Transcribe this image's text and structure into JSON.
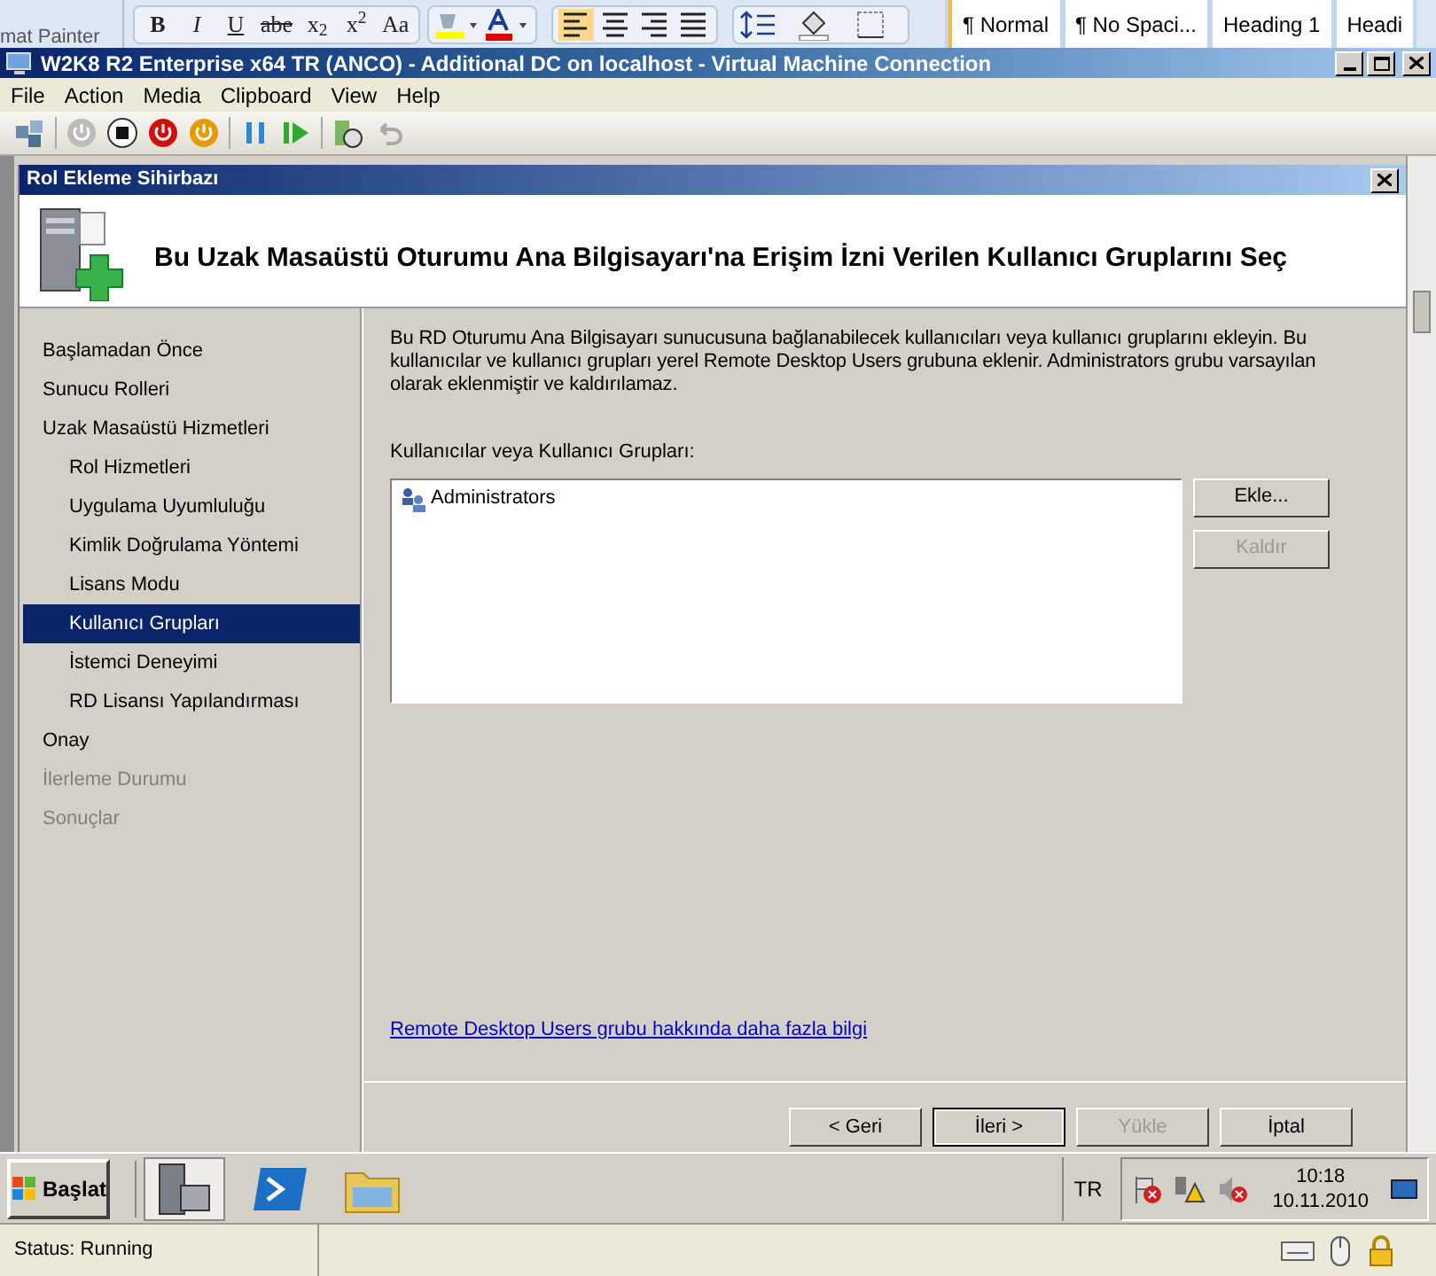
{
  "word_ribbon": {
    "cut_label": "mat Painter",
    "format_buttons": [
      "B",
      "I",
      "U",
      "abe",
      "x$_{2}$",
      "x$^{2}$",
      "Aa"
    ],
    "styles": [
      {
        "label": "¶ Normal",
        "selected": true
      },
      {
        "label": "¶ No Spaci...",
        "selected": false
      },
      {
        "label": "Heading 1",
        "selected": false
      },
      {
        "label": "Headi",
        "selected": false
      }
    ]
  },
  "vm_window": {
    "title": "W2K8 R2 Enterprise x64 TR (ANCO) - Additional DC on localhost - Virtual Machine Connection",
    "menu": [
      "File",
      "Action",
      "Media",
      "Clipboard",
      "View",
      "Help"
    ]
  },
  "wizard": {
    "title": "Rol Ekleme Sihirbazı",
    "heading": "Bu Uzak Masaüstü Oturumu Ana Bilgisayarı'na Erişim İzni Verilen Kullanıcı Gruplarını Seç",
    "nav": [
      {
        "label": "Başlamadan Önce",
        "selected": false,
        "disabled": false
      },
      {
        "label": "Sunucu Rolleri",
        "selected": false,
        "disabled": false
      },
      {
        "label": "Uzak Masaüstü Hizmetleri",
        "selected": false,
        "disabled": false,
        "children": [
          {
            "label": "Rol Hizmetleri",
            "selected": false,
            "disabled": false
          },
          {
            "label": "Uygulama Uyumluluğu",
            "selected": false,
            "disabled": false
          },
          {
            "label": "Kimlik Doğrulama Yöntemi",
            "selected": false,
            "disabled": false
          },
          {
            "label": "Lisans Modu",
            "selected": false,
            "disabled": false
          },
          {
            "label": "Kullanıcı Grupları",
            "selected": true,
            "disabled": false
          },
          {
            "label": "İstemci Deneyimi",
            "selected": false,
            "disabled": false
          },
          {
            "label": "RD Lisansı Yapılandırması",
            "selected": false,
            "disabled": false
          }
        ]
      },
      {
        "label": "Onay",
        "selected": false,
        "disabled": false
      },
      {
        "label": "İlerleme Durumu",
        "selected": false,
        "disabled": true
      },
      {
        "label": "Sonuçlar",
        "selected": false,
        "disabled": true
      }
    ],
    "description": "Bu RD Oturumu Ana Bilgisayarı sunucusuna bağlanabilecek kullanıcıları veya kullanıcı gruplarını ekleyin. Bu kullanıcılar ve kullanıcı grupları yerel Remote Desktop Users grubuna eklenir. Administrators grubu varsayılan olarak eklenmiştir ve kaldırılamaz.",
    "list_label": "Kullanıcılar veya Kullanıcı Grupları:",
    "list_items": [
      "Administrators"
    ],
    "side_buttons": [
      {
        "label": "Ekle...",
        "disabled": false
      },
      {
        "label": "Kaldır",
        "disabled": true
      }
    ],
    "link": "Remote Desktop Users grubu hakkında daha fazla bilgi",
    "footer_buttons": [
      {
        "label": "< Geri",
        "disabled": false,
        "default": false
      },
      {
        "label": "İleri >",
        "disabled": false,
        "default": true
      },
      {
        "label": "Yükle",
        "disabled": true,
        "default": false
      },
      {
        "label": "İptal",
        "disabled": false,
        "default": false
      }
    ]
  },
  "taskbar": {
    "start": "Başlat",
    "language": "TR",
    "time": "10:18",
    "date": "10.11.2010"
  },
  "status_bar": {
    "status": "Status: Running"
  }
}
